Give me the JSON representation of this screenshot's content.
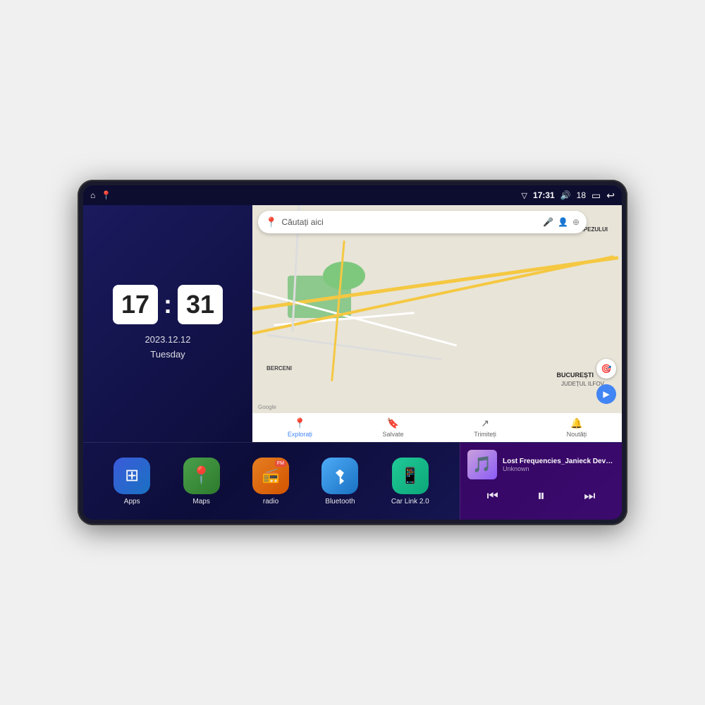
{
  "device": {
    "screen_bg": "#0a0a2a"
  },
  "status_bar": {
    "signal_icon": "▽",
    "time": "17:31",
    "volume_icon": "🔊",
    "volume_level": "18",
    "battery_icon": "▭",
    "back_icon": "↩"
  },
  "clock": {
    "hours": "17",
    "minutes": "31",
    "date": "2023.12.12",
    "day": "Tuesday"
  },
  "map": {
    "search_placeholder": "Căutați aici",
    "nav_items": [
      {
        "label": "Explorați",
        "active": true
      },
      {
        "label": "Salvate",
        "active": false
      },
      {
        "label": "Trimiteți",
        "active": false
      },
      {
        "label": "Noutăți",
        "active": false
      }
    ],
    "labels": {
      "trapezului": "TRAPEZULUI",
      "bucuresti": "BUCUREȘTI",
      "judet": "JUDEȚUL ILFOV",
      "berceni": "BERCENI"
    }
  },
  "apps": [
    {
      "name": "Apps",
      "icon": "⊞",
      "bg_class": "apps-bg"
    },
    {
      "name": "Maps",
      "icon": "📍",
      "bg_class": "maps-bg"
    },
    {
      "name": "radio",
      "icon": "📻",
      "bg_class": "radio-bg"
    },
    {
      "name": "Bluetooth",
      "icon": "⚡",
      "bg_class": "bt-bg"
    },
    {
      "name": "Car Link 2.0",
      "icon": "🔗",
      "bg_class": "carlink-bg"
    }
  ],
  "music": {
    "title": "Lost Frequencies_Janieck Devy-...",
    "artist": "Unknown",
    "prev_btn": "⏮",
    "play_btn": "⏸",
    "next_btn": "⏭"
  }
}
